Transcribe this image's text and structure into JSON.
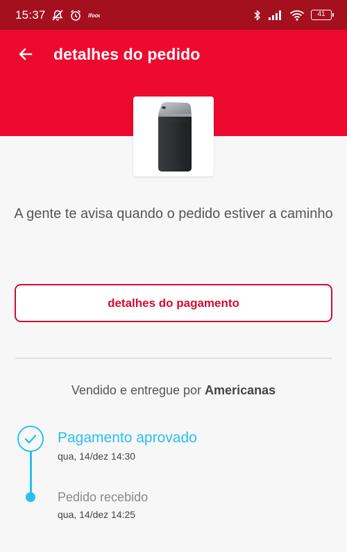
{
  "status_bar": {
    "time": "15:37",
    "battery": "41",
    "icons": [
      "muted-notifications-icon",
      "alarm-icon",
      "app-notification-icon",
      "bluetooth-icon",
      "signal-icon",
      "wifi-icon",
      "battery-icon"
    ]
  },
  "header": {
    "title": "detalhes do pedido",
    "back_icon": "back-arrow-icon"
  },
  "product": {
    "image": "bluetooth-speaker"
  },
  "notice": "A gente te avisa quando o pedido estiver a caminho",
  "payment_button": "detalhes do pagamento",
  "seller": {
    "prefix": "Vendido e entregue por",
    "name": "Americanas"
  },
  "timeline": [
    {
      "title": "Pagamento aprovado",
      "date": "qua, 14/dez 14:30",
      "status": "done"
    },
    {
      "title": "Pedido recebido",
      "date": "qua, 14/dez 14:25",
      "status": "done"
    }
  ],
  "colors": {
    "status_bar": "#a4101e",
    "header": "#ee0a2f",
    "accent": "#d10c2f",
    "timeline": "#29c0f0"
  }
}
